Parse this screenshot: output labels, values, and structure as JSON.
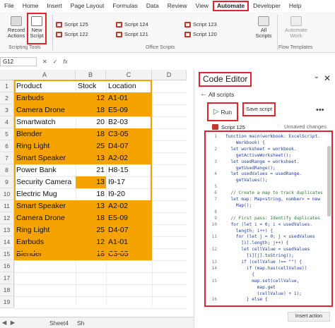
{
  "menu": {
    "tabs": [
      "File",
      "Home",
      "Insert",
      "Page Layout",
      "Formulas",
      "Data",
      "Review",
      "View",
      "Automate",
      "Developer",
      "Help"
    ],
    "active": "Automate"
  },
  "ribbon": {
    "record_label": "Record Actions",
    "new_script_label": "New Script",
    "scripting_tools_label": "Scripting Tools",
    "office_scripts_label": "Office Scripts",
    "flow_templates_label": "Flow Templates",
    "all_scripts_label": "All Scripts",
    "automate_work_label": "Automate Work",
    "scripts": [
      "Script 125",
      "Script 124",
      "Script 123",
      "Script 122",
      "Script 121",
      "Script 120"
    ]
  },
  "formula_bar": {
    "cell_ref": "G12",
    "fx": "fx"
  },
  "grid": {
    "columns": [
      "A",
      "B",
      "C",
      "D"
    ],
    "rows": [
      "1",
      "2",
      "3",
      "4",
      "5",
      "6",
      "7",
      "8",
      "9",
      "10",
      "11",
      "12",
      "13",
      "14",
      "15",
      "16",
      "17",
      "18",
      "19"
    ],
    "headers": [
      "Product",
      "Stock",
      "Location"
    ],
    "data": [
      [
        "Earbuds",
        "12",
        "A1-01"
      ],
      [
        "Camera Drone",
        "18",
        "E5-09"
      ],
      [
        "Smartwatch",
        "20",
        "B2-03"
      ],
      [
        "Blender",
        "18",
        "C3-05"
      ],
      [
        "Ring Light",
        "25",
        "D4-07"
      ],
      [
        "Smart Speaker",
        "13",
        "A2-02"
      ],
      [
        "Power Bank",
        "21",
        "H8-15"
      ],
      [
        "Security Camera",
        "13",
        "I9-17"
      ],
      [
        "Electric Mug",
        "18",
        "I9-20"
      ],
      [
        "Smart Speaker",
        "13",
        "A2-02"
      ],
      [
        "Camera Drone",
        "18",
        "E5-09"
      ],
      [
        "Ring Light",
        "25",
        "D4-07"
      ],
      [
        "Earbuds",
        "12",
        "A1-01"
      ],
      [
        "Blender",
        "18",
        "C3-05"
      ]
    ],
    "highlight_color": "#F5A300"
  },
  "sheets": [
    "Sheet4",
    "Sh"
  ],
  "editor": {
    "title": "Code Editor",
    "all_scripts": "All scripts",
    "run_label": "Run",
    "save_label": "Save script",
    "unsaved": "Unsaved changes",
    "script_name": "Script 125",
    "insert_action": "Insert action",
    "code": [
      {
        "n": "1",
        "t": "function main(workbook: ExcelScript."
      },
      {
        "n": "",
        "t": "    Workbook) {"
      },
      {
        "n": "2",
        "t": "  let worksheet = workbook."
      },
      {
        "n": "",
        "t": "    getActiveWorksheet();"
      },
      {
        "n": "3",
        "t": "  let usedRange = worksheet."
      },
      {
        "n": "",
        "t": "    getUsedRange();"
      },
      {
        "n": "4",
        "t": "  let usedValues = usedRange."
      },
      {
        "n": "",
        "t": "    getValues();"
      },
      {
        "n": "5",
        "t": ""
      },
      {
        "n": "6",
        "t": "  // Create a map to track duplicates",
        "c": true
      },
      {
        "n": "7",
        "t": "  let map: Map<string, number> = new"
      },
      {
        "n": "",
        "t": "    Map();"
      },
      {
        "n": "8",
        "t": ""
      },
      {
        "n": "9",
        "t": "  // First pass: Identify duplicates",
        "c": true
      },
      {
        "n": "10",
        "t": "  for (let i = 0; i < usedValues."
      },
      {
        "n": "",
        "t": "    length; i++) {"
      },
      {
        "n": "11",
        "t": "    for (let j = 0; j < usedValues"
      },
      {
        "n": "",
        "t": "      [i].length; j++) {"
      },
      {
        "n": "12",
        "t": "      let cellValue = usedValues"
      },
      {
        "n": "",
        "t": "        [i][j].toString();"
      },
      {
        "n": "13",
        "t": "      if (cellValue !== \"\") {"
      },
      {
        "n": "14",
        "t": "        if (map.has(cellValue))"
      },
      {
        "n": "",
        "t": "          {"
      },
      {
        "n": "15",
        "t": "          map.set(cellValue,"
      },
      {
        "n": "",
        "t": "            map.get"
      },
      {
        "n": "",
        "t": "            (cellValue) + 1);"
      },
      {
        "n": "16",
        "t": "        } else {"
      }
    ]
  }
}
